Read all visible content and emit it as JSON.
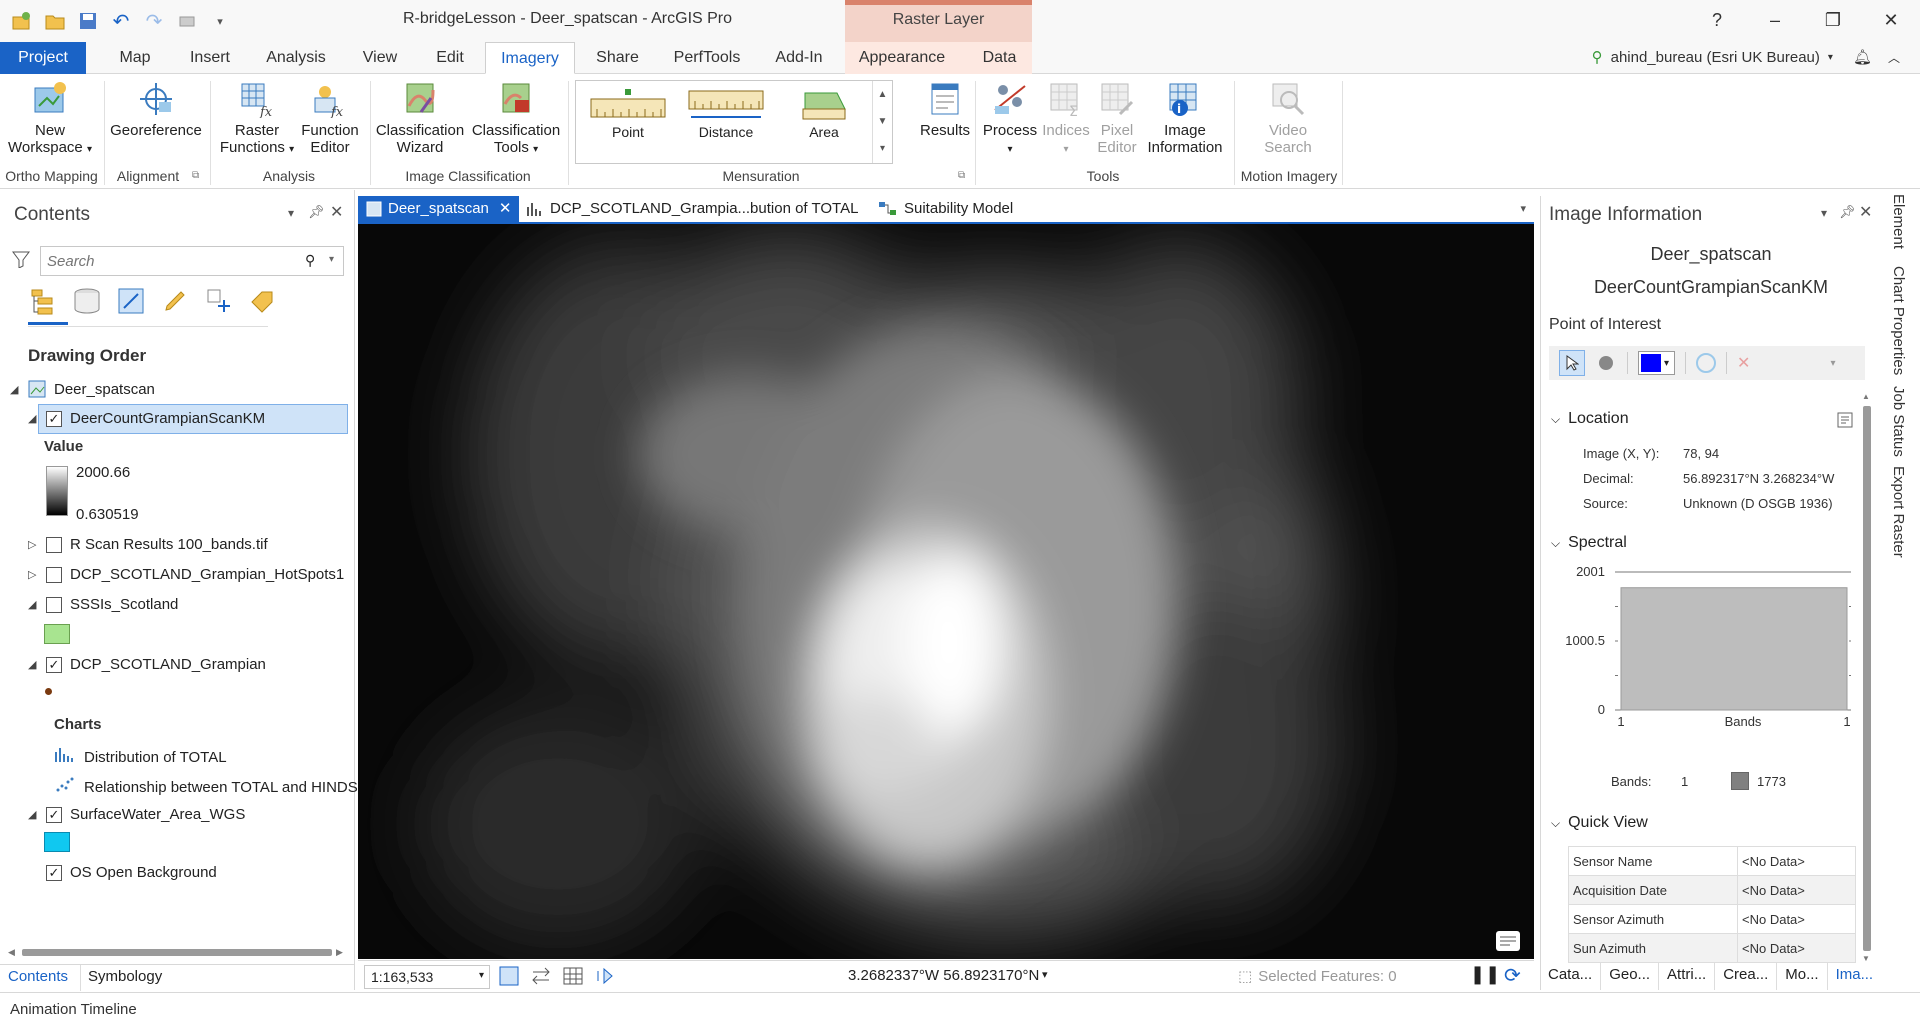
{
  "window": {
    "title": "R-bridgeLesson - Deer_spatscan - ArcGIS Pro",
    "context_group": "Raster Layer",
    "help": "?",
    "minimize": "–",
    "maximize": "❐",
    "close": "✕"
  },
  "ribbon_tabs": [
    "Project",
    "Map",
    "Insert",
    "Analysis",
    "View",
    "Edit",
    "Imagery",
    "Share",
    "PerfTools",
    "Add-In",
    "Appearance",
    "Data"
  ],
  "active_tab": "Imagery",
  "user": "ahind_bureau (Esri UK Bureau)",
  "ribbon": {
    "ortho": {
      "btn1": "New",
      "btn2": "Workspace",
      "group": "Ortho Mapping"
    },
    "alignment": {
      "btn": "Georeference",
      "group": "Alignment"
    },
    "analysis": {
      "raster1": "Raster",
      "raster2": "Functions",
      "func1": "Function",
      "func2": "Editor",
      "group": "Analysis"
    },
    "classification": {
      "wiz1": "Classification",
      "wiz2": "Wizard",
      "tools1": "Classification",
      "tools2": "Tools",
      "group": "Image Classification"
    },
    "mensuration": {
      "point": "Point",
      "distance": "Distance",
      "area": "Area",
      "results": "Results",
      "group": "Mensuration"
    },
    "tools": {
      "process": "Process",
      "indices": "Indices",
      "pixel1": "Pixel",
      "pixel2": "Editor",
      "info1": "Image",
      "info2": "Information",
      "group": "Tools"
    },
    "motion": {
      "video1": "Video",
      "video2": "Search",
      "group": "Motion Imagery"
    }
  },
  "contents": {
    "title": "Contents",
    "search_placeholder": "Search",
    "drawing_order": "Drawing Order",
    "map": "Deer_spatscan",
    "layer_selected": "DeerCountGrampianScanKM",
    "value_label": "Value",
    "value_max": "2000.66",
    "value_min": "0.630519",
    "layers": {
      "rscan": "R Scan Results 100_bands.tif",
      "hotspots": "DCP_SCOTLAND_Grampian_HotSpots1",
      "sssi": "SSSIs_Scotland",
      "grampian": "DCP_SCOTLAND_Grampian",
      "charts": "Charts",
      "chart1": "Distribution of TOTAL",
      "chart2": "Relationship between TOTAL and HINDS",
      "water": "SurfaceWater_Area_WGS",
      "os": "OS Open Background"
    },
    "tab_contents": "Contents",
    "tab_symbology": "Symbology"
  },
  "map_tabs": {
    "t1": "Deer_spatscan",
    "t2": "DCP_SCOTLAND_Grampia...bution of TOTAL",
    "t3": "Suitability Model"
  },
  "map_status": {
    "scale": "1:163,533",
    "coords": "3.2682337°W 56.8923170°N",
    "selected": "Selected Features: 0"
  },
  "image_info": {
    "title": "Image Information",
    "name1": "Deer_spatscan",
    "name2": "DeerCountGrampianScanKM",
    "poi": "Point of Interest",
    "location": "Location",
    "image_xy_label": "Image (X, Y):",
    "image_xy": "78, 94",
    "decimal_label": "Decimal:",
    "decimal": "56.892317°N 3.268234°W",
    "source_label": "Source:",
    "source": "Unknown (D OSGB 1936)",
    "spectral": "Spectral",
    "bands_label": "Bands:",
    "bands_count": "1",
    "band_value": "1773",
    "quick_view": "Quick View",
    "quick_rows": [
      {
        "k": "Sensor Name",
        "v": "<No Data>"
      },
      {
        "k": "Acquisition Date",
        "v": "<No Data>"
      },
      {
        "k": "Sensor Azimuth",
        "v": "<No Data>"
      },
      {
        "k": "Sun Azimuth",
        "v": "<No Data>"
      }
    ],
    "bottom_tabs": [
      "Cata...",
      "Geo...",
      "Attri...",
      "Crea...",
      "Mo...",
      "Ima..."
    ]
  },
  "chart_data": {
    "type": "bar",
    "categories": [
      "1"
    ],
    "values": [
      1773
    ],
    "xlabel": "Bands",
    "ylabel": "",
    "yticks": [
      "0",
      "1000.5",
      "2001"
    ],
    "xticks": [
      "1",
      "1"
    ],
    "ylim": [
      0,
      2001
    ],
    "grid": true,
    "bar_color": "#bdbdbd"
  },
  "side_tabs": [
    "Element",
    "Chart Properties",
    "Job Status",
    "Export Raster"
  ],
  "animation_timeline": "Animation Timeline",
  "colors": {
    "accent": "#1a63c6",
    "context": "#f3d3c9",
    "selection": "#cfe3f8",
    "sssi_fill": "#a8e490",
    "water_fill": "#10c8f0",
    "poi_color": "#0000ff"
  }
}
